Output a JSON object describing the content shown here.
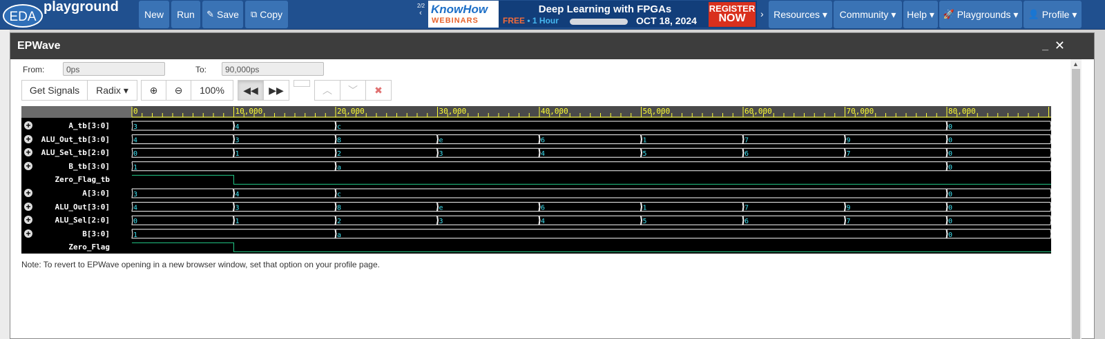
{
  "nav": {
    "brand_badge": "EDA",
    "brand_name": "playground",
    "buttons": {
      "new": "New",
      "run": "Run",
      "save": "Save",
      "copy": "Copy"
    },
    "menus": {
      "resources": "Resources ▾",
      "community": "Community ▾",
      "help": "Help ▾",
      "playgrounds": "Playgrounds ▾",
      "profile": "Profile ▾"
    }
  },
  "banner": {
    "pager": "2/2",
    "brand": "KnowHow",
    "brand_sub": "WEBINARS",
    "title": "Deep Learning with FPGAs",
    "free": "FREE",
    "duration": "• 1 Hour",
    "date": "OCT 18, 2024",
    "cta_line1": "REGISTER",
    "cta_line2": "NOW"
  },
  "modal": {
    "title": "EPWave",
    "from_label": "From:",
    "from_value": "0ps",
    "to_label": "To:",
    "to_value": "90,000ps",
    "get_signals": "Get Signals",
    "radix": "Radix ▾",
    "zoom": "100%",
    "note": "Note: To revert to EPWave opening in a new browser window, set that option on your profile page."
  },
  "colors": {
    "navbar": "#20508f",
    "wave_trace": "#ffffff",
    "wave_value": "#3fe0f0",
    "ruler_text": "#ffff33"
  },
  "waveform": {
    "time_start": 0,
    "time_end": 90000,
    "ruler_labels": [
      "0",
      "10,000",
      "20,000",
      "30,000",
      "40,000",
      "50,000",
      "60,000",
      "70,000",
      "80,000"
    ],
    "signals": [
      {
        "name": "A_tb[3:0]",
        "expandable": true,
        "type": "bus",
        "changes": [
          [
            0,
            "3"
          ],
          [
            10000,
            "4"
          ],
          [
            20000,
            "c"
          ],
          [
            80000,
            "0"
          ]
        ]
      },
      {
        "name": "ALU_Out_tb[3:0]",
        "expandable": true,
        "type": "bus",
        "changes": [
          [
            0,
            "4"
          ],
          [
            10000,
            "3"
          ],
          [
            20000,
            "8"
          ],
          [
            30000,
            "e"
          ],
          [
            40000,
            "6"
          ],
          [
            50000,
            "1"
          ],
          [
            60000,
            "7"
          ],
          [
            70000,
            "9"
          ],
          [
            80000,
            "0"
          ]
        ]
      },
      {
        "name": "ALU_Sel_tb[2:0]",
        "expandable": true,
        "type": "bus",
        "changes": [
          [
            0,
            "0"
          ],
          [
            10000,
            "1"
          ],
          [
            20000,
            "2"
          ],
          [
            30000,
            "3"
          ],
          [
            40000,
            "4"
          ],
          [
            50000,
            "5"
          ],
          [
            60000,
            "6"
          ],
          [
            70000,
            "7"
          ],
          [
            80000,
            "0"
          ]
        ]
      },
      {
        "name": "B_tb[3:0]",
        "expandable": true,
        "type": "bus",
        "changes": [
          [
            0,
            "1"
          ],
          [
            20000,
            "a"
          ],
          [
            80000,
            "0"
          ]
        ]
      },
      {
        "name": "Zero_Flag_tb",
        "expandable": false,
        "type": "bit",
        "changes": [
          [
            0,
            1
          ],
          [
            10000,
            0
          ]
        ]
      },
      {
        "name": "A[3:0]",
        "expandable": true,
        "type": "bus",
        "changes": [
          [
            0,
            "3"
          ],
          [
            10000,
            "4"
          ],
          [
            20000,
            "c"
          ],
          [
            80000,
            "0"
          ]
        ]
      },
      {
        "name": "ALU_Out[3:0]",
        "expandable": true,
        "type": "bus",
        "changes": [
          [
            0,
            "4"
          ],
          [
            10000,
            "3"
          ],
          [
            20000,
            "8"
          ],
          [
            30000,
            "e"
          ],
          [
            40000,
            "6"
          ],
          [
            50000,
            "1"
          ],
          [
            60000,
            "7"
          ],
          [
            70000,
            "9"
          ],
          [
            80000,
            "0"
          ]
        ]
      },
      {
        "name": "ALU_Sel[2:0]",
        "expandable": true,
        "type": "bus",
        "changes": [
          [
            0,
            "0"
          ],
          [
            10000,
            "1"
          ],
          [
            20000,
            "2"
          ],
          [
            30000,
            "3"
          ],
          [
            40000,
            "4"
          ],
          [
            50000,
            "5"
          ],
          [
            60000,
            "6"
          ],
          [
            70000,
            "7"
          ],
          [
            80000,
            "0"
          ]
        ]
      },
      {
        "name": "B[3:0]",
        "expandable": true,
        "type": "bus",
        "changes": [
          [
            0,
            "1"
          ],
          [
            20000,
            "a"
          ],
          [
            80000,
            "0"
          ]
        ]
      },
      {
        "name": "Zero_Flag",
        "expandable": false,
        "type": "bit",
        "changes": [
          [
            0,
            1
          ],
          [
            10000,
            0
          ]
        ]
      }
    ]
  }
}
